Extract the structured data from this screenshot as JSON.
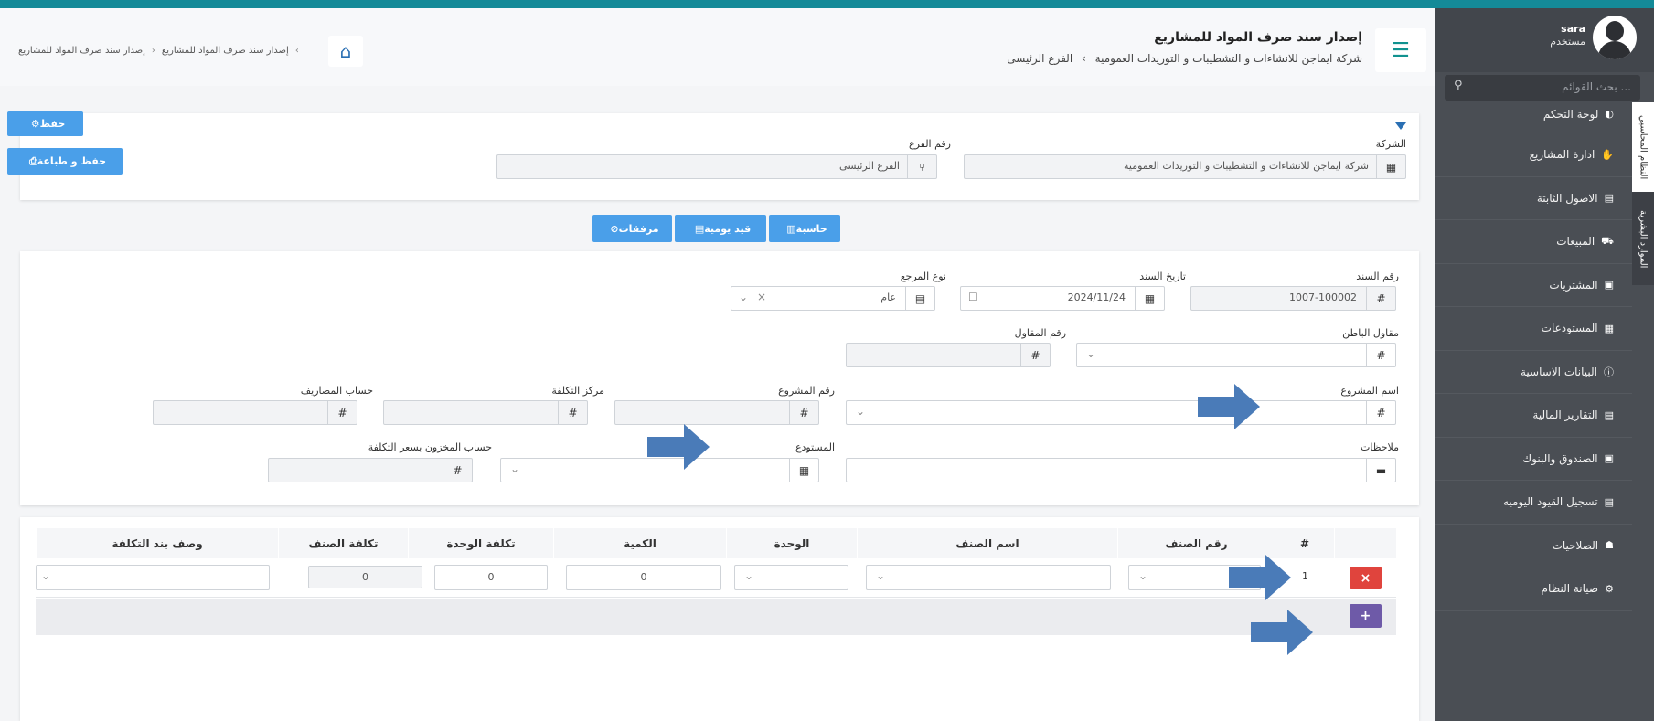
{
  "header": {
    "title": "إصدار سند صرف المواد للمشاريع",
    "company": "شركة ايماجن للانشاءات و التشطيبات و التوريدات العمومية",
    "branch": "الفرع الرئيسى",
    "menu_icon": "list-icon"
  },
  "breadcrumb": {
    "home_icon": "home-icon",
    "items": [
      "إصدار سند صرف المواد للمشاريع",
      "إصدار سند صرف المواد للمشاريع"
    ]
  },
  "sidebar": {
    "user_name": "sara",
    "user_role": "مستخدم",
    "search_placeholder": "بحث القوائم ...",
    "vertical_tabs": [
      "النظام المحاسبي",
      "الموارد البشرية"
    ],
    "items": [
      {
        "label": "لوحة التحكم",
        "icon": "dashboard-icon"
      },
      {
        "label": "ادارة المشاريع",
        "icon": "handshake-icon"
      },
      {
        "label": "الاصول الثابتة",
        "icon": "file-icon"
      },
      {
        "label": "المبيعات",
        "icon": "truck-icon"
      },
      {
        "label": "المشتريات",
        "icon": "money-icon"
      },
      {
        "label": "المستودعات",
        "icon": "archive-icon"
      },
      {
        "label": "البيانات الاساسية",
        "icon": "info-icon"
      },
      {
        "label": "التقارير المالية",
        "icon": "file-icon"
      },
      {
        "label": "الصندوق والبنوك",
        "icon": "money-icon"
      },
      {
        "label": "تسجيل القيود اليوميه",
        "icon": "file-icon"
      },
      {
        "label": "الصلاحيات",
        "icon": "users-icon"
      },
      {
        "label": "صيانة النظام",
        "icon": "gear-icon"
      }
    ]
  },
  "actions": {
    "save": "حفظ",
    "save_print": "حفظ و طباعة"
  },
  "company_section": {
    "company_label": "الشركة",
    "company_value": "شركة ايماجن للانشاءات و التشطيبات و التوريدات العمومية",
    "branch_label": "رقم الفرع",
    "branch_value": "الفرع الرئيسى"
  },
  "tabs": {
    "calculator": "حاسبة",
    "journal": "قيد يومية",
    "attachments": "مرفقات"
  },
  "form": {
    "voucher_no_label": "رقم السند",
    "voucher_no": "1007-100002",
    "voucher_date_label": "تاريخ السند",
    "voucher_date": "2024/11/24",
    "ref_type_label": "نوع المرجع",
    "ref_type": "عام",
    "subcontractor_label": "مقاول الباطن",
    "contractor_no_label": "رقم المقاول",
    "project_name_label": "اسم المشروع",
    "project_no_label": "رقم المشروع",
    "cost_center_label": "مركز التكلفة",
    "expense_account_label": "حساب المصاريف",
    "notes_label": "ملاحظات",
    "warehouse_label": "المستودع",
    "inventory_account_label": "حساب المخزون بسعر التكلفة",
    "hash": "#"
  },
  "table": {
    "headers": [
      "#",
      "رقم الصنف",
      "اسم الصنف",
      "الوحدة",
      "الكمية",
      "تكلفة الوحدة",
      "تكلفة الصنف",
      "وصف بند التكلفة"
    ],
    "rows": [
      {
        "index": "1",
        "quantity": "0",
        "unit_cost": "0",
        "item_cost": "0"
      }
    ],
    "delete_label": "×",
    "add_label": "+"
  },
  "colors": {
    "accent": "#148a98",
    "button_blue": "#4a9fe9",
    "delete_red": "#e0443d",
    "add_purple": "#6e5aa8",
    "arrow_blue": "#4a7bb8"
  }
}
